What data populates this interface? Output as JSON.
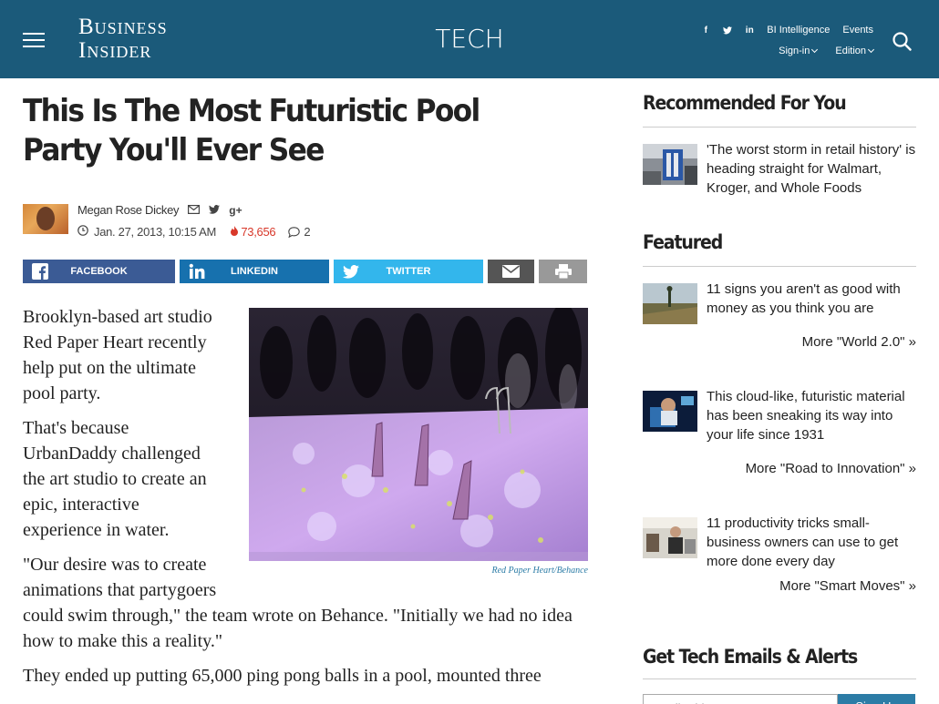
{
  "header": {
    "logo_line1": "Business",
    "logo_line2": "Insider",
    "section": "TECH",
    "social": [
      "f",
      "t",
      "in"
    ],
    "links": {
      "intelligence": "BI Intelligence",
      "events": "Events",
      "signin": "Sign-in",
      "edition": "Edition"
    }
  },
  "article": {
    "title": "This Is The Most Futuristic Pool Party You'll Ever See",
    "author": "Megan Rose Dickey",
    "date": "Jan. 27, 2013, 10:15 AM",
    "views": "73,656",
    "comments": "2",
    "share": {
      "facebook": "FACEBOOK",
      "linkedin": "LINKEDIN",
      "twitter": "TWITTER"
    },
    "caption": "Red Paper Heart/Behance",
    "paragraphs": [
      "Brooklyn-based art studio Red Paper Heart recently help put on the ultimate pool party.",
      "That's because UrbanDaddy challenged the art studio to create an epic, interactive experience in water.",
      "\"Our desire was to create animations that partygoers could swim through,\" the team wrote on Behance. \"Initially we had no idea how to make this a reality.\"",
      "They ended up putting 65,000 ping pong balls in a pool, mounted three"
    ]
  },
  "sidebar": {
    "recommended": {
      "heading": "Recommended For You",
      "items": [
        {
          "text": "'The worst storm in retail history' is heading straight for Walmart, Kroger, and Whole Foods"
        }
      ]
    },
    "featured": {
      "heading": "Featured",
      "items": [
        {
          "text": "11 signs you aren't as good with money as you think you are",
          "more": "More \"World 2.0\" »"
        },
        {
          "text": "This cloud-like, futuristic material has been sneaking its way into your life since 1931",
          "more": "More \"Road to Innovation\" »"
        },
        {
          "text": "11 productivity tricks small-business owners can use to get more done every day",
          "more": "More \"Smart Moves\" »"
        }
      ]
    },
    "emails": {
      "heading": "Get Tech Emails & Alerts",
      "placeholder": "Email Address",
      "button": "Sign Up"
    }
  },
  "colors": {
    "header_bg": "#1b5a7a",
    "facebook": "#3b5b95",
    "linkedin": "#1771ae",
    "twitter": "#33b6ec",
    "views": "#d8382a",
    "caption": "#2c7ca6"
  }
}
